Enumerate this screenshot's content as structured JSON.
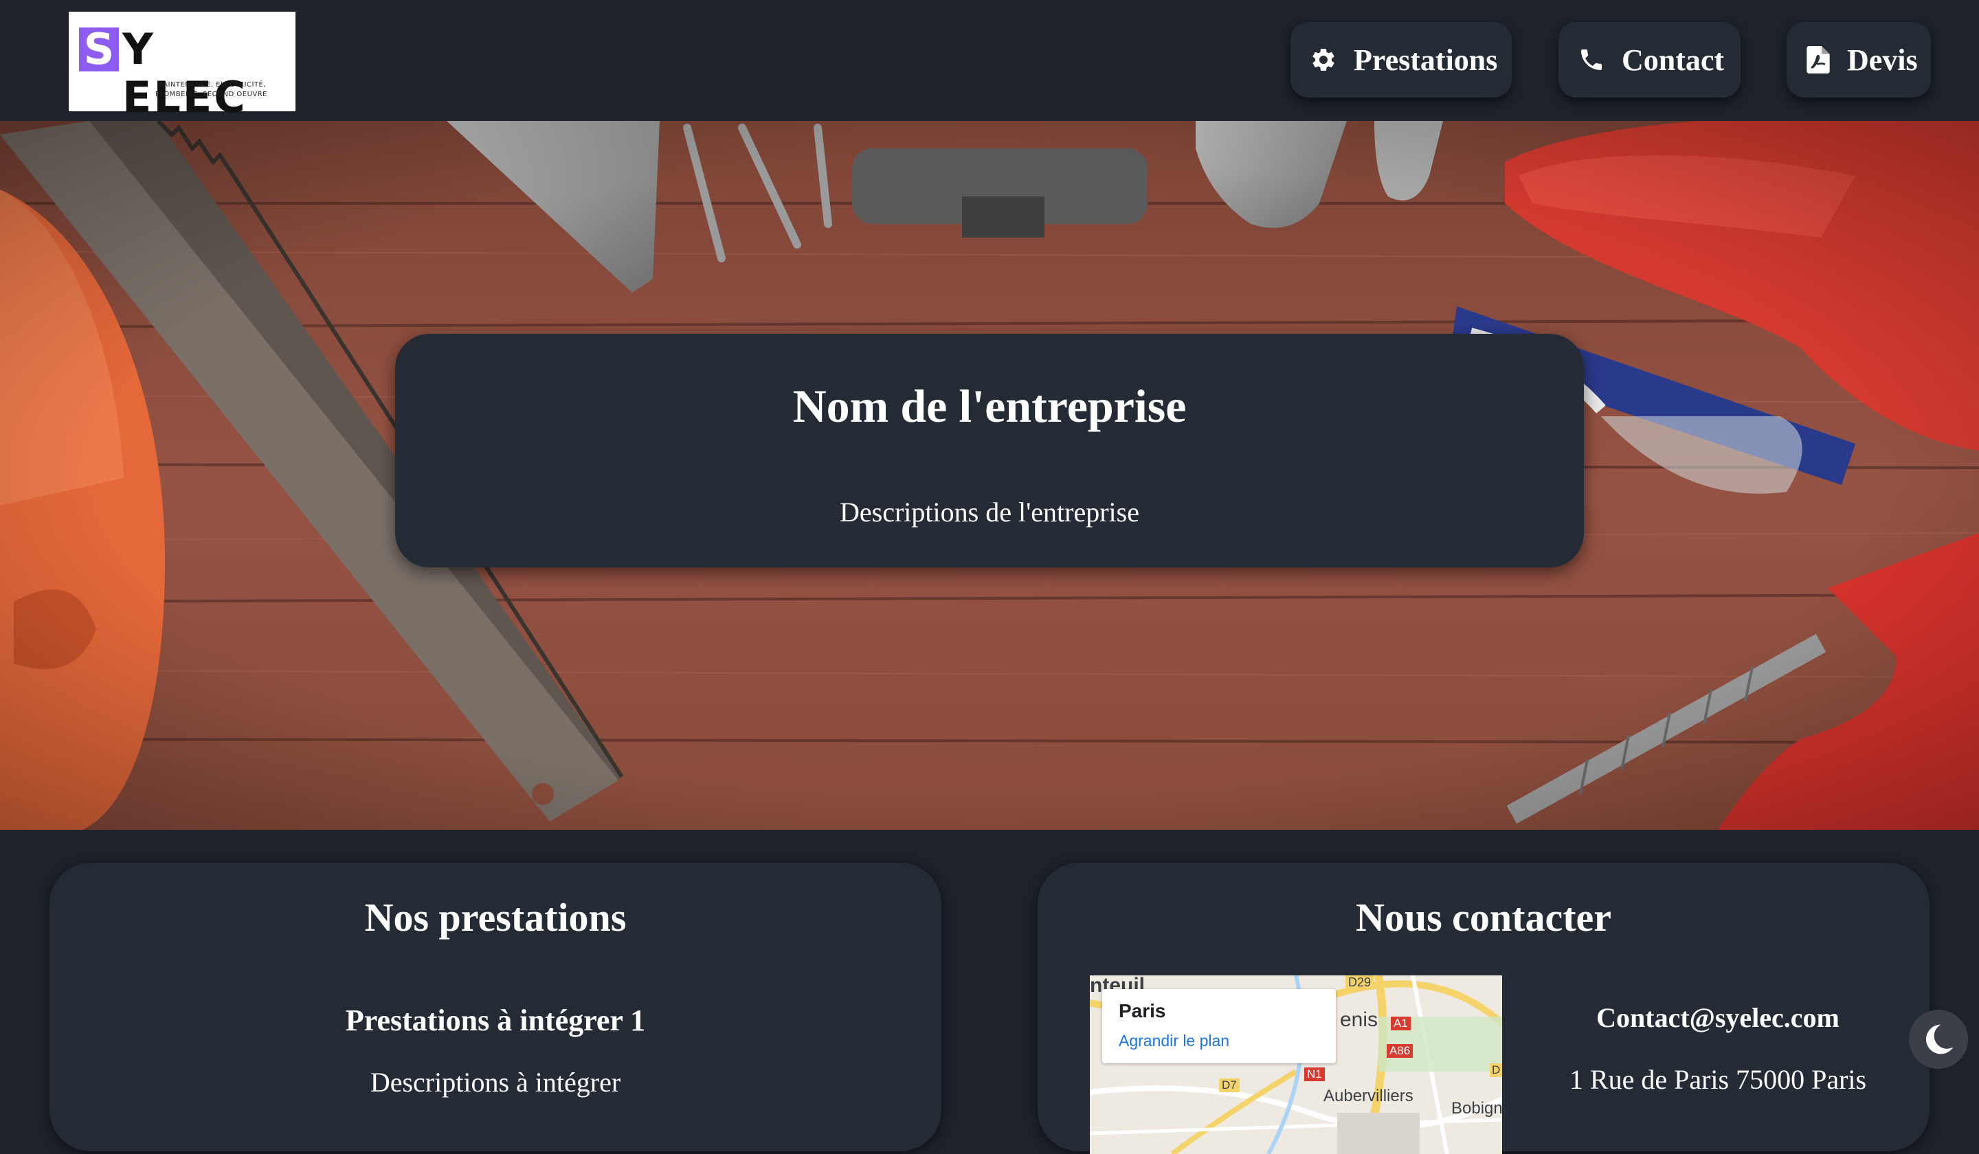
{
  "brand": {
    "logo_letter": "S",
    "logo_text": "Y ELEC",
    "tagline_line1": "MAINTENANCE, ELECTRICITÉ,",
    "tagline_line2": "PLOMBERIE, SECOND OEUVRE",
    "accent_color": "#8d5cf0"
  },
  "nav": {
    "items": [
      {
        "label": "Prestations",
        "icon": "gear-icon"
      },
      {
        "label": "Contact",
        "icon": "phone-icon"
      },
      {
        "label": "Devis",
        "icon": "pdf-file-icon"
      }
    ]
  },
  "hero": {
    "title": "Nom de l'entreprise",
    "description": "Descriptions de l'entreprise"
  },
  "services": {
    "title": "Nos prestations",
    "items": [
      {
        "name": "Prestations à intégrer 1",
        "description": "Descriptions à intégrer"
      }
    ]
  },
  "contact": {
    "title": "Nous contacter",
    "email": "Contact@syelec.com",
    "address": "1 Rue de Paris 75000 Paris",
    "map": {
      "place": "Paris",
      "link": "Agrandir le plan",
      "labels": [
        "nteuil",
        "D29",
        "enis",
        "A1",
        "A86",
        "N1",
        "D7",
        "Aubervilliers",
        "Bobign",
        "D"
      ]
    }
  },
  "theme_toggle": {
    "icon": "moon-icon"
  },
  "colors": {
    "page_bg": "#1d222b",
    "card_bg": "#252b35",
    "text": "#ffffff",
    "map_link": "#1a73e8"
  }
}
